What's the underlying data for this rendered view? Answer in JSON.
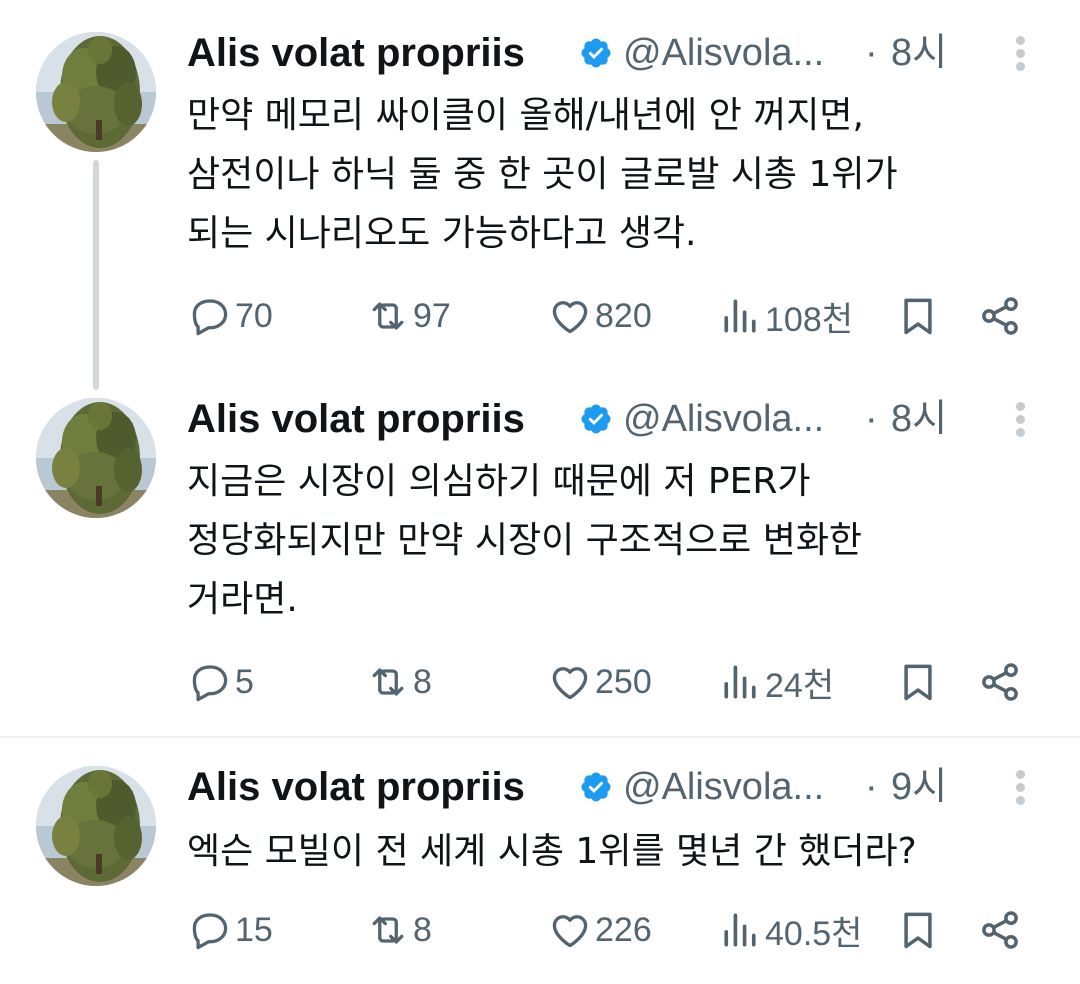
{
  "colors": {
    "text": "#0f1419",
    "secondary": "#536471",
    "verified": "#1d9bf0",
    "divider": "#eff3f4",
    "thread_line": "#cfd9de"
  },
  "icons": {
    "reply": "speech-bubble-icon",
    "retweet": "retweet-arrows-icon",
    "like": "heart-icon",
    "views": "bar-chart-icon",
    "bookmark": "bookmark-icon",
    "share": "share-nodes-icon",
    "more": "vertical-dots-icon",
    "verified": "verified-badge-icon"
  },
  "tweets": [
    {
      "author_name": "Alis volat propriis",
      "handle": "@Alisvola...",
      "separator": "·",
      "time": "8시",
      "lines": [
        "만약 메모리 싸이클이 올해/내년에 안 꺼지면,",
        "삼전이나 하닉 둘 중 한 곳이 글로발 시총 1위가",
        "되는 시나리오도 가능하다고 생각."
      ],
      "replies": "70",
      "retweets": "97",
      "likes": "820",
      "views": "108천"
    },
    {
      "author_name": "Alis volat propriis",
      "handle": "@Alisvola...",
      "separator": "·",
      "time": "8시",
      "lines": [
        "지금은 시장이 의심하기 때문에 저 PER가",
        "정당화되지만 만약 시장이 구조적으로 변화한",
        "거라면."
      ],
      "replies": "5",
      "retweets": "8",
      "likes": "250",
      "views": "24천"
    },
    {
      "author_name": "Alis volat propriis",
      "handle": "@Alisvola...",
      "separator": "·",
      "time": "9시",
      "lines": [
        "엑슨 모빌이 전 세계 시총 1위를 몇년 간 했더라?"
      ],
      "replies": "15",
      "retweets": "8",
      "likes": "226",
      "views": "40.5천"
    }
  ]
}
